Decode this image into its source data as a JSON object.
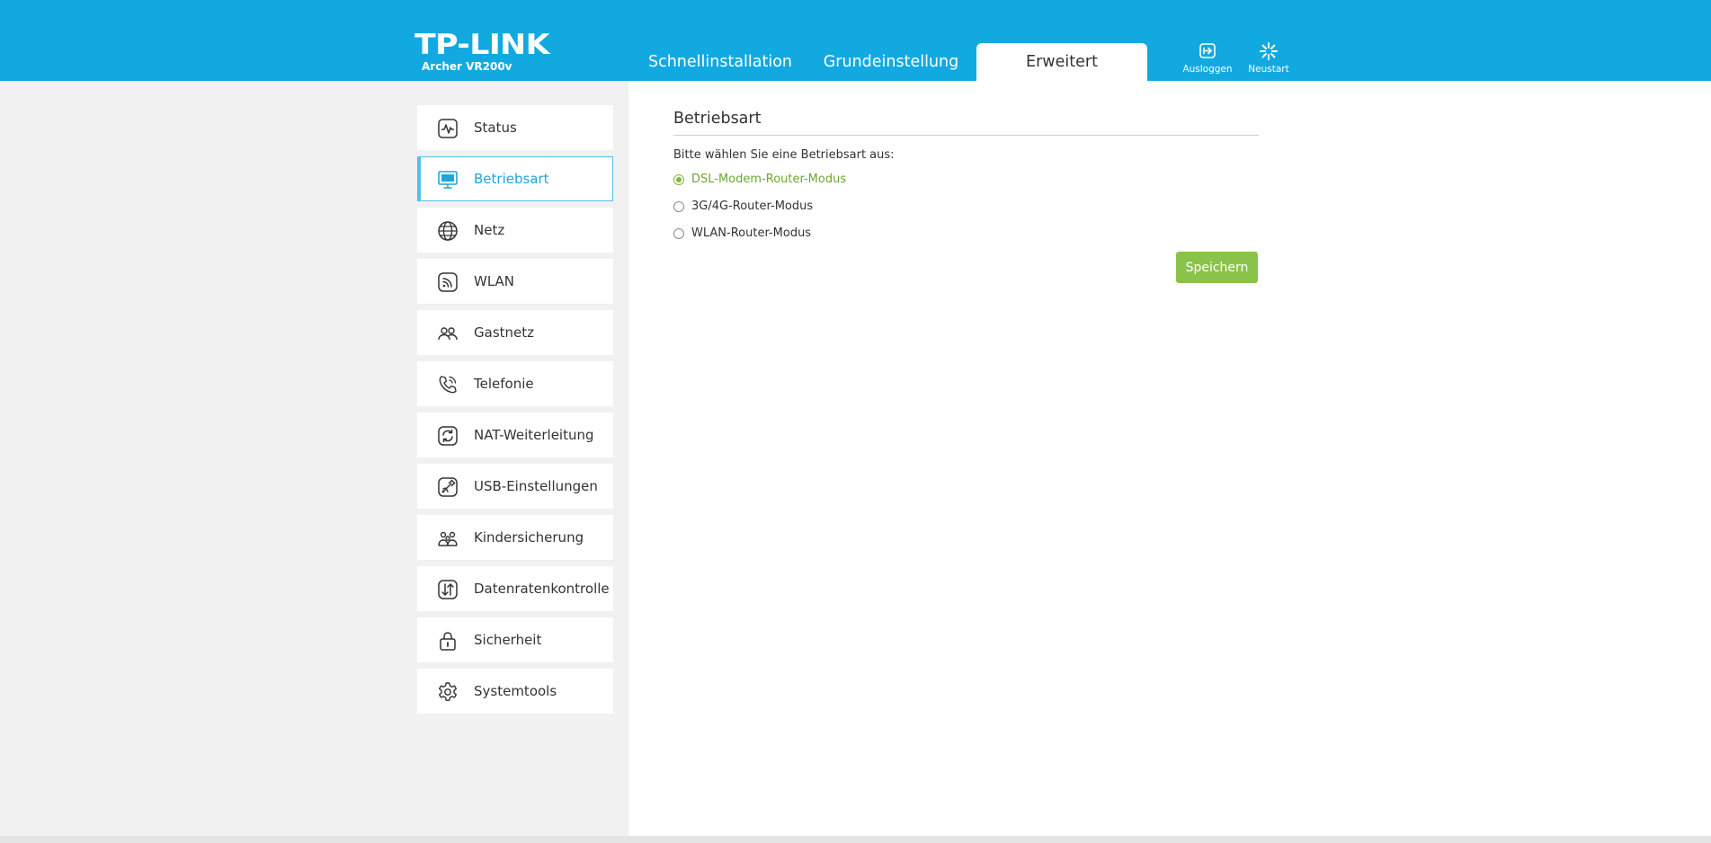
{
  "header": {
    "brand": "TP-LINK",
    "model": "Archer VR200v",
    "tabs": [
      {
        "label": "Schnellinstallation"
      },
      {
        "label": "Grundeinstellung"
      },
      {
        "label": "Erweitert",
        "active": true
      }
    ],
    "logout_label": "Ausloggen",
    "reboot_label": "Neustart",
    "logout_icon": "logout-icon",
    "reboot_icon": "reboot-spinner-icon"
  },
  "colors": {
    "header": "#12a9e0",
    "accent": "#1ea6dd",
    "selected_green": "#7dbb3c",
    "save_button": "#8bc34a",
    "sidebar_bg": "#f1f1f1"
  },
  "sidebar": {
    "items": [
      {
        "label": "Status",
        "icon": "status-pulse-icon"
      },
      {
        "label": "Betriebsart",
        "icon": "monitor-icon",
        "active": true
      },
      {
        "label": "Netz",
        "icon": "globe-icon"
      },
      {
        "label": "WLAN",
        "icon": "wifi-icon"
      },
      {
        "label": "Gastnetz",
        "icon": "guests-icon"
      },
      {
        "label": "Telefonie",
        "icon": "phone-icon"
      },
      {
        "label": "NAT-Weiterleitung",
        "icon": "nat-refresh-icon"
      },
      {
        "label": "USB-Einstellungen",
        "icon": "usb-icon"
      },
      {
        "label": "Kindersicherung",
        "icon": "family-icon"
      },
      {
        "label": "Datenratenkontrolle",
        "icon": "bandwidth-icon"
      },
      {
        "label": "Sicherheit",
        "icon": "lock-icon"
      },
      {
        "label": "Systemtools",
        "icon": "gear-icon"
      }
    ]
  },
  "main": {
    "title": "Betriebsart",
    "prompt": "Bitte wählen Sie eine Betriebsart aus:",
    "options": [
      {
        "label": "DSL-Modem-Router-Modus",
        "selected": true
      },
      {
        "label": "3G/4G-Router-Modus",
        "selected": false
      },
      {
        "label": "WLAN-Router-Modus",
        "selected": false
      }
    ],
    "save_label": "Speichern"
  }
}
